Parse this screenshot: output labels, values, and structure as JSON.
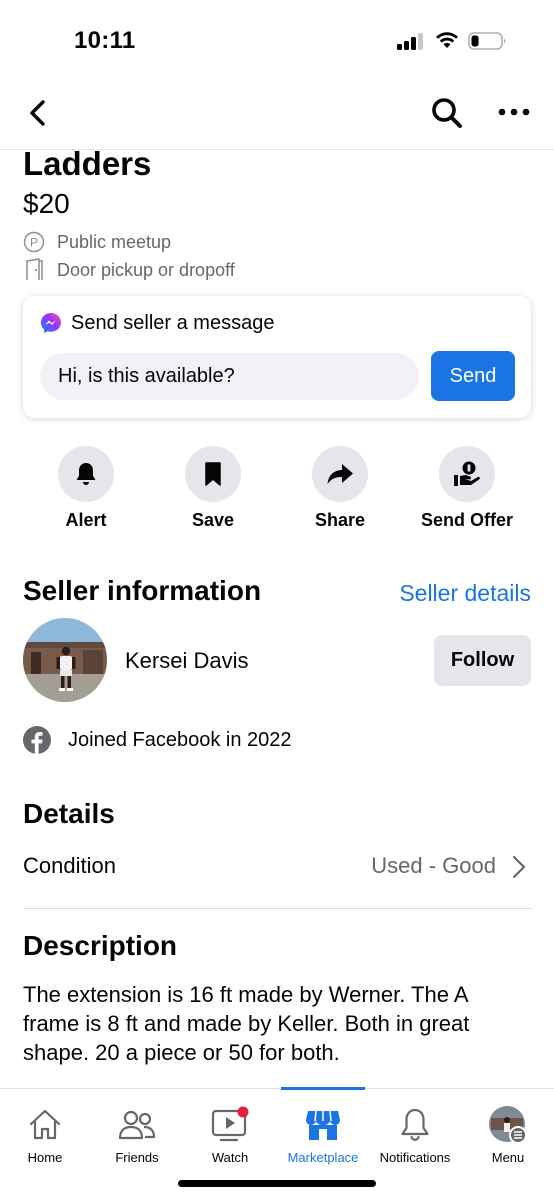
{
  "status_bar": {
    "time": "10:11"
  },
  "listing": {
    "title": "Ladders",
    "price": "$20",
    "meta": [
      {
        "icon": "parking-icon",
        "label": "Public meetup"
      },
      {
        "icon": "door-icon",
        "label": "Door pickup or dropoff"
      }
    ]
  },
  "message": {
    "heading": "Send seller a message",
    "input_value": "Hi, is this available?",
    "send_label": "Send"
  },
  "actions": [
    {
      "icon": "bell-icon",
      "label": "Alert"
    },
    {
      "icon": "bookmark-icon",
      "label": "Save"
    },
    {
      "icon": "share-arrow-icon",
      "label": "Share"
    },
    {
      "icon": "offer-hand-icon",
      "label": "Send Offer"
    }
  ],
  "seller": {
    "section_title": "Seller information",
    "details_link": "Seller details",
    "name": "Kersei Davis",
    "follow_label": "Follow",
    "joined": "Joined Facebook in 2022"
  },
  "details": {
    "section_title": "Details",
    "condition_label": "Condition",
    "condition_value": "Used - Good"
  },
  "description": {
    "section_title": "Description",
    "text": "The extension is 16 ft made by Werner. The A frame is 8 ft and made by Keller. Both in great shape. 20 a piece or 50 for both."
  },
  "tabs": [
    {
      "icon": "home-icon",
      "label": "Home"
    },
    {
      "icon": "friends-icon",
      "label": "Friends"
    },
    {
      "icon": "watch-icon",
      "label": "Watch"
    },
    {
      "icon": "marketplace-icon",
      "label": "Marketplace"
    },
    {
      "icon": "notifications-bell-icon",
      "label": "Notifications"
    },
    {
      "icon": "menu-avatar-icon",
      "label": "Menu"
    }
  ],
  "colors": {
    "accent": "#1b74e4",
    "secondary_text": "#65676b",
    "chip_bg": "#e4e6eb",
    "badge": "#e41e3f"
  }
}
